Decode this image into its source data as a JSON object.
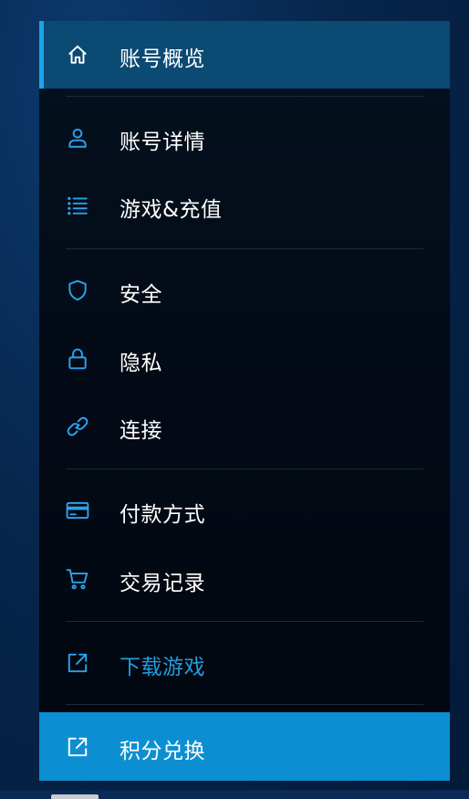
{
  "menu": {
    "items": [
      {
        "label": "账号概览",
        "icon": "home-icon"
      },
      {
        "label": "账号详情",
        "icon": "user-icon"
      },
      {
        "label": "游戏&充值",
        "icon": "list-icon"
      },
      {
        "label": "安全",
        "icon": "shield-icon"
      },
      {
        "label": "隐私",
        "icon": "lock-icon"
      },
      {
        "label": "连接",
        "icon": "link-icon"
      },
      {
        "label": "付款方式",
        "icon": "credit-card-icon"
      },
      {
        "label": "交易记录",
        "icon": "cart-icon"
      },
      {
        "label": "下载游戏",
        "icon": "external-link-icon"
      },
      {
        "label": "积分兑换",
        "icon": "external-link-icon"
      }
    ]
  },
  "colors": {
    "accent": "#1aa4ea",
    "active_bg": "#0b4a73",
    "cta_bg": "#0c8fd2",
    "link_text": "#1f9de0",
    "icon_blue": "#2aa2ee"
  }
}
